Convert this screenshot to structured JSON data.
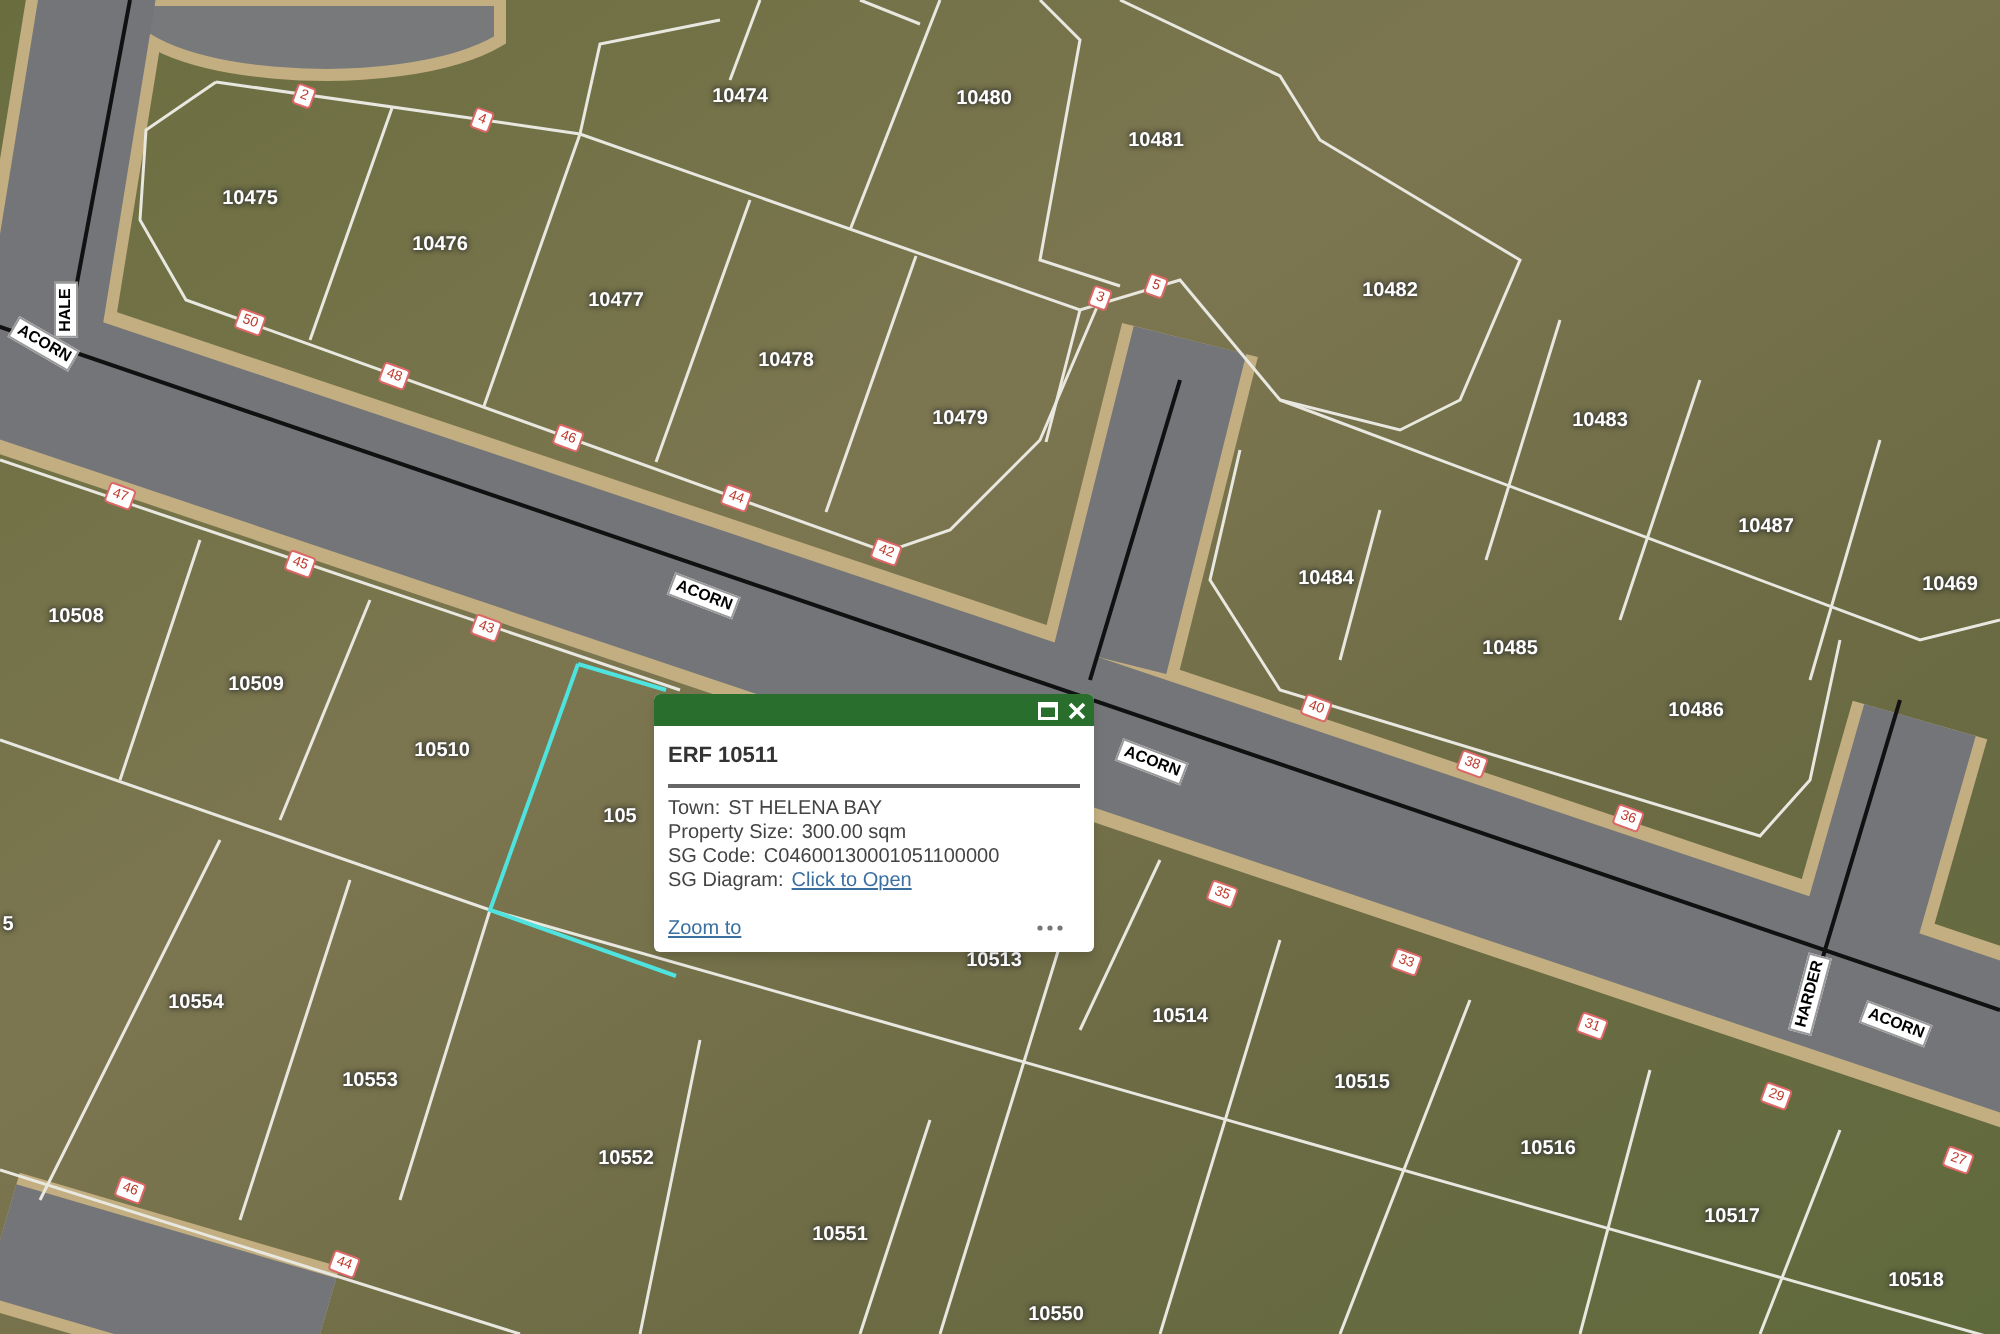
{
  "map": {
    "parcel_labels": [
      "10474",
      "10480",
      "10481",
      "10475",
      "10476",
      "10477",
      "10478",
      "10479",
      "10482",
      "10483",
      "10487",
      "10469",
      "10484",
      "10485",
      "10486",
      "10508",
      "10509",
      "10510",
      "105",
      "10513",
      "10554",
      "10553",
      "10552",
      "10551",
      "10550",
      "10514",
      "10515",
      "10516",
      "10517",
      "10518",
      "5"
    ],
    "street_labels": [
      "HALE",
      "ACORN",
      "ACORN",
      "ACORN",
      "HARDER",
      "ACORN"
    ],
    "lot_numbers": [
      "2",
      "4",
      "50",
      "48",
      "46",
      "44",
      "42",
      "47",
      "45",
      "43",
      "46",
      "44",
      "40",
      "38",
      "36",
      "35",
      "33",
      "31",
      "29",
      "27",
      "5",
      "3"
    ]
  },
  "popup": {
    "title": "ERF 10511",
    "fields": [
      {
        "label": "Town:",
        "value": "ST HELENA BAY",
        "kind": "text"
      },
      {
        "label": "Property Size:",
        "value": "300.00 sqm",
        "kind": "text"
      },
      {
        "label": "SG Code:",
        "value": "C04600130001051100000",
        "kind": "text"
      },
      {
        "label": "SG Diagram:",
        "value": "Click to Open",
        "kind": "link"
      }
    ],
    "action": "Zoom to"
  }
}
